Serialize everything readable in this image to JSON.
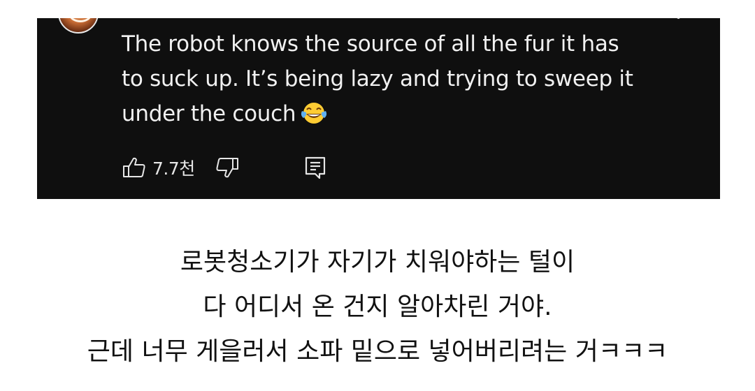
{
  "comment": {
    "avatar_icon": "user-avatar",
    "more_icon": "three-dot-menu-icon",
    "text_lines": [
      "The robot knows the source of all the fur it has",
      "to suck up. It’s being lazy and trying to sweep it",
      "under the couch"
    ],
    "emoji_icon": "face-with-tears-of-joy-icon",
    "likes": "7.7천",
    "like_icon": "thumbs-up-icon",
    "dislike_icon": "thumbs-down-icon",
    "reply_icon": "reply-comment-icon",
    "card_background": "#0f0f0f",
    "text_color": "#f1f1f1"
  },
  "caption": {
    "lines": [
      "로봇청소기가 자기가 치워야하는 털이",
      "다 어디서 온 건지 알아차린 거야.",
      "근데 너무 게을러서 소파 밑으로 넣어버리려는 거ㅋㅋㅋ"
    ],
    "text_color": "#111111"
  }
}
